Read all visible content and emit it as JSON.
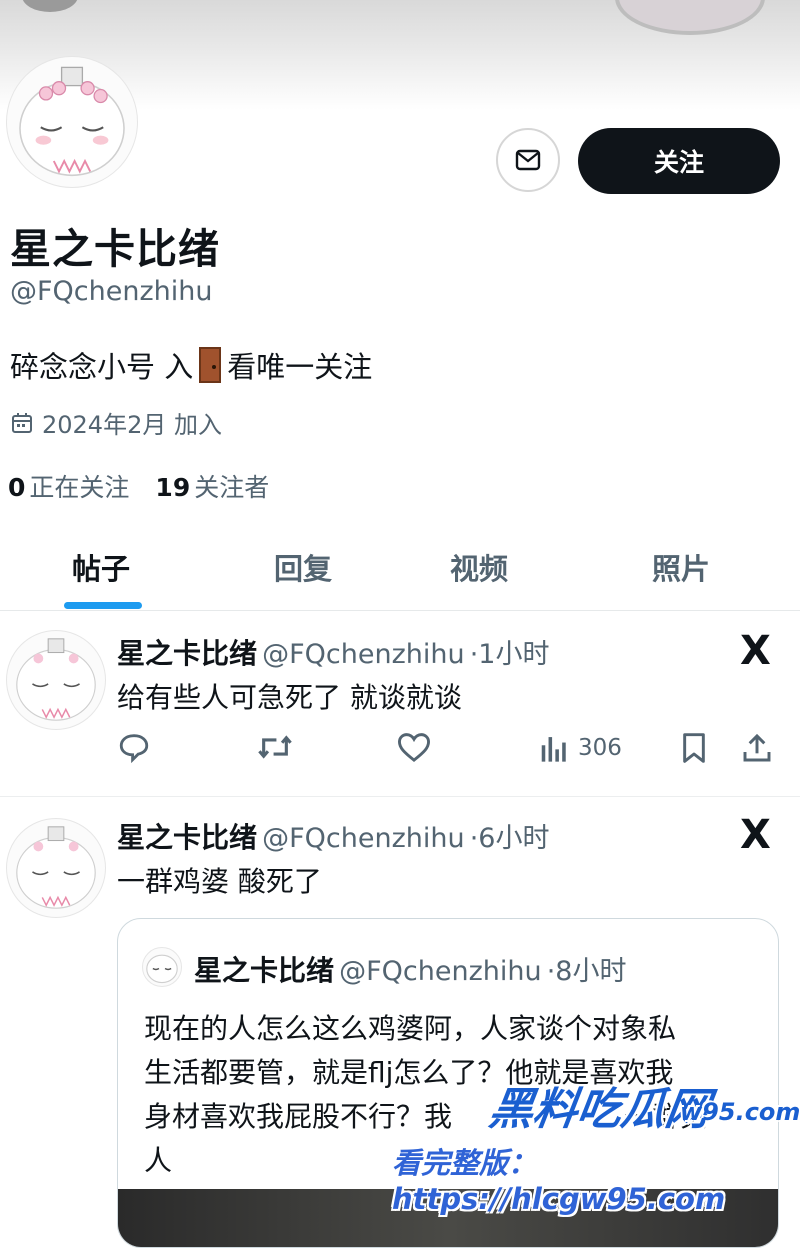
{
  "profile": {
    "name": "星之卡比绪",
    "handle": "@FQchenzhihu",
    "bio_before": "碎念念小号 入",
    "bio_after": "看唯一关注",
    "joined": "2024年2月 加入",
    "following_count": "0",
    "following_label": "正在关注",
    "followers_count": "19",
    "followers_label": "关注者",
    "follow_button": "关注"
  },
  "tabs": [
    {
      "label": "帖子",
      "active": true
    },
    {
      "label": "回复",
      "active": false
    },
    {
      "label": "视频",
      "active": false
    },
    {
      "label": "照片",
      "active": false
    }
  ],
  "posts": [
    {
      "name": "星之卡比绪",
      "handle": "@FQchenzhihu",
      "time": "·1小时",
      "text": "给有些人可急死了 就谈就谈",
      "views": "306",
      "platform_icon": "X"
    },
    {
      "name": "星之卡比绪",
      "handle": "@FQchenzhihu",
      "time": "·6小时",
      "text": "一群鸡婆 酸死了",
      "platform_icon": "X",
      "quote": {
        "name": "星之卡比绪",
        "handle": "@FQchenzhihu",
        "time": "·8小时",
        "lines": [
          "现在的人怎么这么鸡婆阿，人家谈个对象私",
          "生活都要管，就是flj怎么了？他就是喜欢我",
          "身材喜欢我屁股不行？我",
          "一群贝",
          "人"
        ]
      }
    }
  ],
  "watermark": {
    "brand": "黑料吃瓜网",
    "domain": "w95.com",
    "full": "看完整版：https://hlcgw95.com"
  },
  "colors": {
    "accent": "#1d9bf0",
    "text": "#0f1419",
    "muted": "#536471",
    "follow_bg": "#0f1419",
    "watermark": "#1a5fd0"
  }
}
